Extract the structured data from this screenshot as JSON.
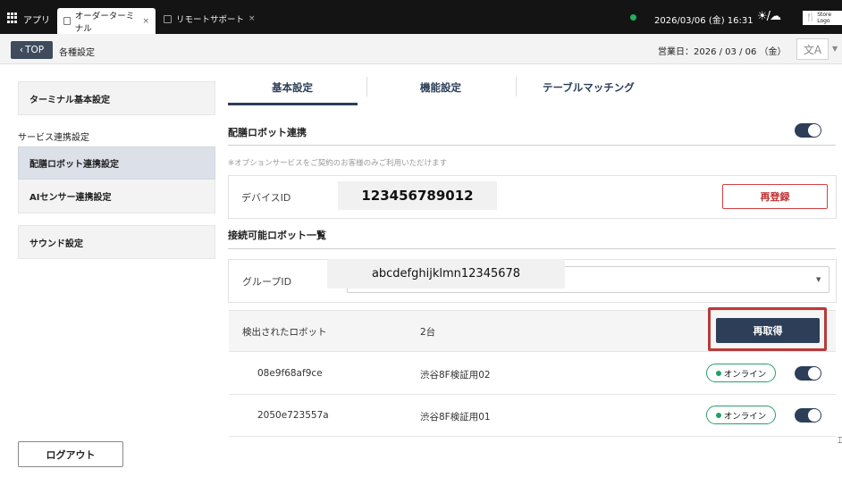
{
  "system_bar": {
    "apps_label": "アプリ",
    "tabs": [
      {
        "label": "オーダーターミナル",
        "close": "×"
      },
      {
        "label": "リモートサポート",
        "close": "×"
      }
    ],
    "datetime": "2026/03/06 (金) 16:31",
    "weather_icon": "sun-cloud-icon",
    "store_logo": "Store Logo",
    "status_color": "#25b060"
  },
  "header": {
    "back_label": "TOP",
    "title": "各種設定",
    "business_date": "営業日：2026 / 03 / 06 （金）",
    "lang_icon": "translate-icon"
  },
  "sidebar": {
    "terminal_basic": "ターミナル基本設定",
    "service_section": "サービス連携設定",
    "items": [
      {
        "label": "配膳ロボット連携設定",
        "selected": true
      },
      {
        "label": "AIセンサー連携設定",
        "selected": false
      }
    ],
    "sound": "サウンド設定",
    "logout": "ログアウト"
  },
  "main": {
    "tabs": [
      {
        "label": "基本設定",
        "active": true
      },
      {
        "label": "機能設定",
        "active": false
      },
      {
        "label": "テーブルマッチング",
        "active": false
      }
    ],
    "robot_section_title": "配膳ロボット連携",
    "robot_enabled": true,
    "option_note": "※オプションサービスをご契約のお客様のみご利用いただけます",
    "device_id_label": "デバイスID",
    "device_id_value": "123456789012",
    "reregister_label": "再登録",
    "robot_list_title": "接続可能ロボット一覧",
    "group_id_label": "グループID",
    "group_id_value": "abcdefghijklmn12345678",
    "detected_label": "検出されたロボット",
    "detected_count": "2台",
    "refetch_label": "再取得",
    "robots": [
      {
        "id": "08e9f68af9ce",
        "name": "渋谷8F検証用02",
        "status": "オンライン",
        "enabled": true
      },
      {
        "id": "2050e723557a",
        "name": "渋谷8F検証用01",
        "status": "オンライン",
        "enabled": true
      }
    ]
  },
  "colors": {
    "accent": "#2c3e58",
    "danger": "#c03030",
    "online": "#22a062",
    "highlight": "#b83a3a"
  }
}
